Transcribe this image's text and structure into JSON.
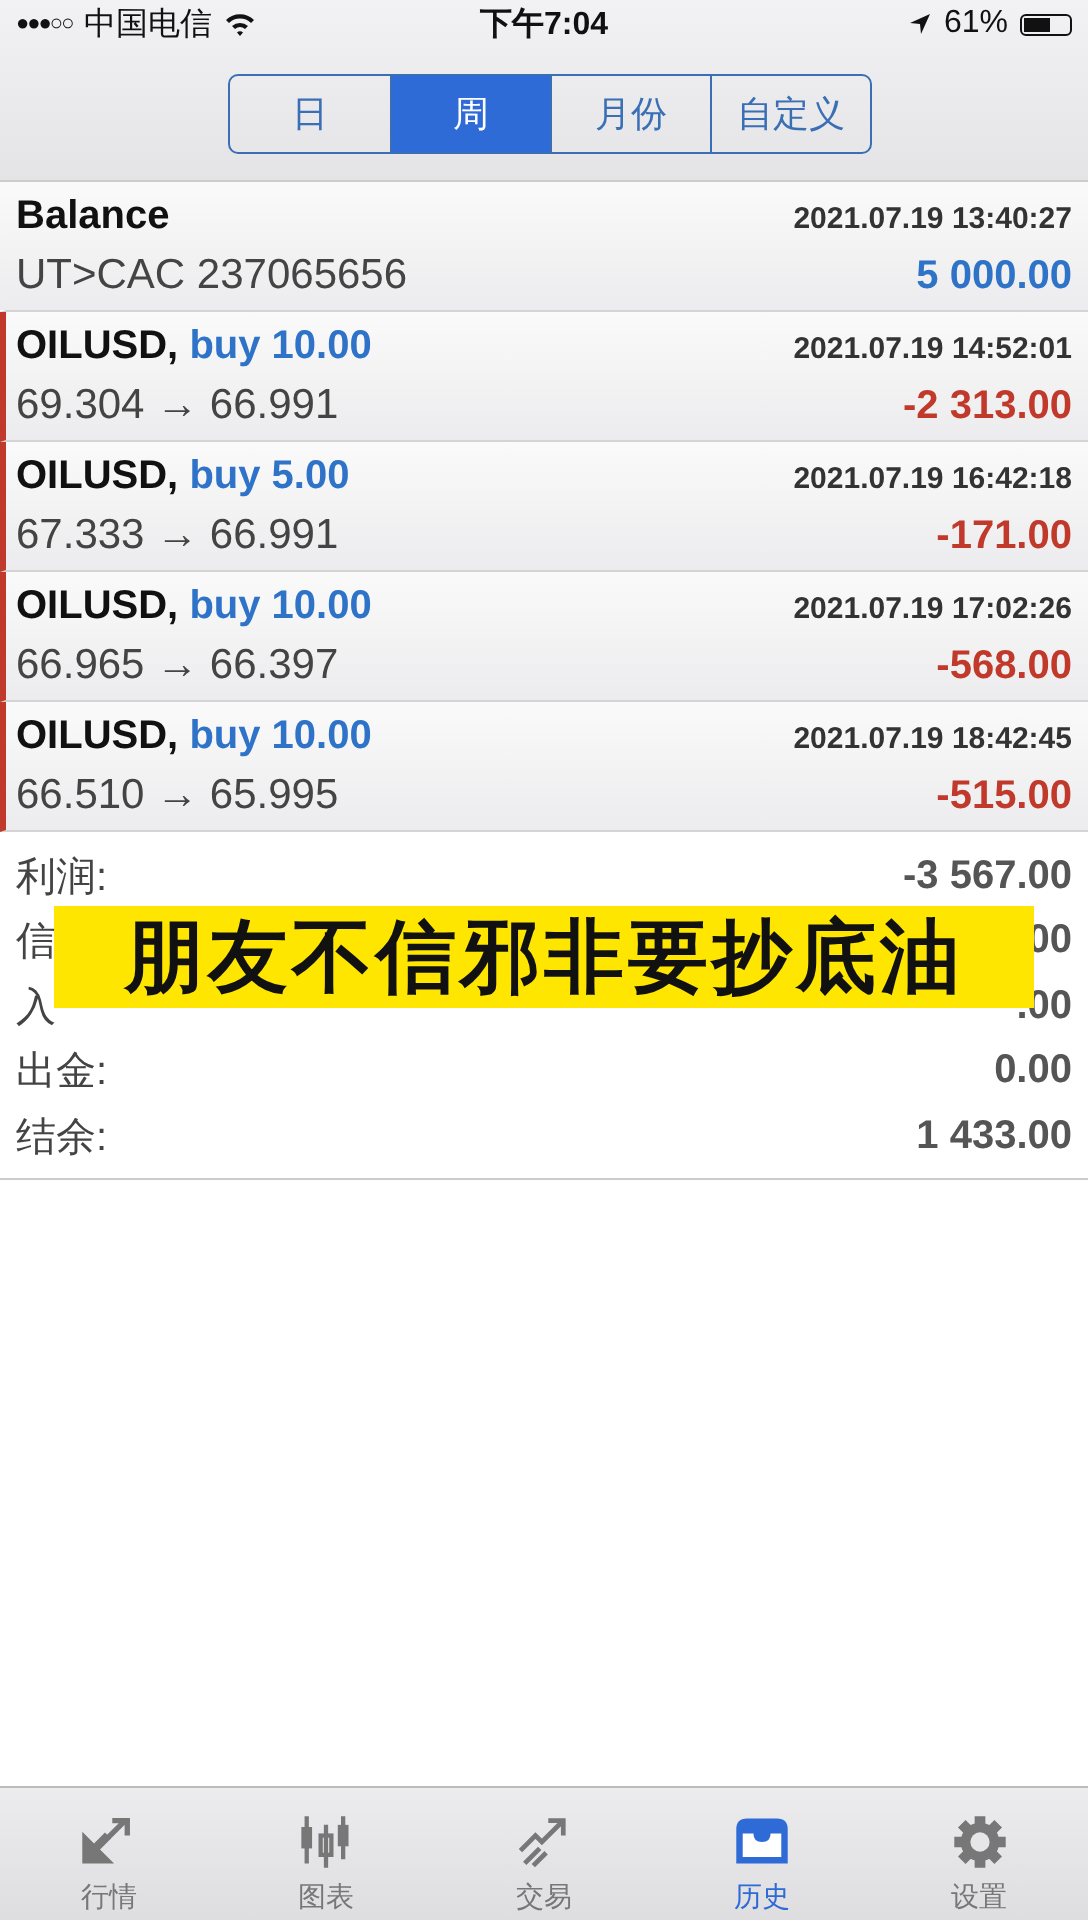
{
  "status_bar": {
    "signal": "●●●○○",
    "carrier": "中国电信",
    "time": "下午7:04",
    "battery_text": "61%"
  },
  "period_tabs": [
    {
      "label": "日",
      "selected": false
    },
    {
      "label": "周",
      "selected": true
    },
    {
      "label": "月份",
      "selected": false
    },
    {
      "label": "自定义",
      "selected": false
    }
  ],
  "history": [
    {
      "kind": "balance",
      "symbol": "Balance",
      "datetime": "2021.07.19 13:40:27",
      "comment": "UT>CAC 237065656",
      "amount": "5 000.00",
      "loss": false
    },
    {
      "kind": "deal",
      "symbol": "OILUSD,",
      "side": "buy 10.00",
      "datetime": "2021.07.19 14:52:01",
      "prices": "69.304 → 66.991",
      "amount": "-2 313.00",
      "loss": true
    },
    {
      "kind": "deal",
      "symbol": "OILUSD,",
      "side": "buy 5.00",
      "datetime": "2021.07.19 16:42:18",
      "prices": "67.333 → 66.991",
      "amount": "-171.00",
      "loss": true
    },
    {
      "kind": "deal",
      "symbol": "OILUSD,",
      "side": "buy 10.00",
      "datetime": "2021.07.19 17:02:26",
      "prices": "66.965 → 66.397",
      "amount": "-568.00",
      "loss": true
    },
    {
      "kind": "deal",
      "symbol": "OILUSD,",
      "side": "buy 10.00",
      "datetime": "2021.07.19 18:42:45",
      "prices": "66.510 → 65.995",
      "amount": "-515.00",
      "loss": true
    }
  ],
  "summary": [
    {
      "label": "利润:",
      "value": "-3 567.00"
    },
    {
      "label": "信",
      "value": "00"
    },
    {
      "label": "入",
      "value": ".00"
    },
    {
      "label": "出金:",
      "value": "0.00"
    },
    {
      "label": "结余:",
      "value": "1 433.00"
    }
  ],
  "caption": "朋友不信邪非要抄底油",
  "tab_bar": [
    {
      "label": "行情",
      "kind": "quotes",
      "selected": false
    },
    {
      "label": "图表",
      "kind": "chart",
      "selected": false
    },
    {
      "label": "交易",
      "kind": "trade",
      "selected": false
    },
    {
      "label": "历史",
      "kind": "history",
      "selected": true
    },
    {
      "label": "设置",
      "kind": "settings",
      "selected": false
    }
  ]
}
